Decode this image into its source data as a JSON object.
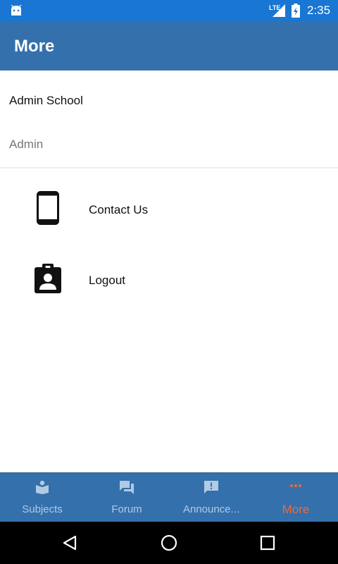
{
  "status_bar": {
    "network": "LTE",
    "time": "2:35",
    "icons": [
      "android-icon",
      "signal-icon",
      "battery-icon"
    ]
  },
  "app_bar": {
    "title": "More"
  },
  "profile": {
    "name": "Admin School",
    "role": "Admin"
  },
  "menu": [
    {
      "label": "Contact Us",
      "icon": "phone-icon"
    },
    {
      "label": "Logout",
      "icon": "badge-icon"
    }
  ],
  "bottom_nav": {
    "tabs": [
      {
        "label": "Subjects",
        "icon": "book-icon",
        "active": false
      },
      {
        "label": "Forum",
        "icon": "forum-icon",
        "active": false
      },
      {
        "label": "Announce...",
        "icon": "announcement-icon",
        "active": false
      },
      {
        "label": "More",
        "icon": "more-dots-icon",
        "active": true
      }
    ]
  },
  "system_nav": {
    "icons": [
      "back-icon",
      "home-icon",
      "recents-icon"
    ]
  },
  "colors": {
    "status_bar": "#1976d2",
    "primary": "#3470ac",
    "active_tab": "#f0683c",
    "inactive_tab": "#b3cae3"
  }
}
